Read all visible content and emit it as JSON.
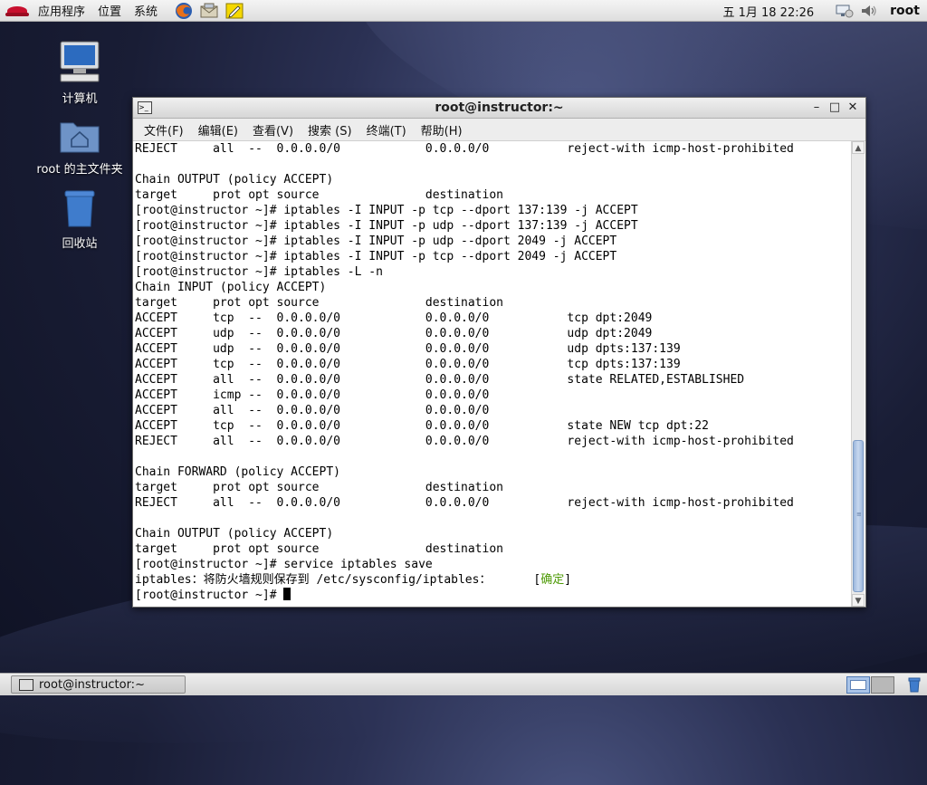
{
  "top_panel": {
    "menus": [
      "应用程序",
      "位置",
      "系统"
    ],
    "clock": "五 1月 18 22:26",
    "user": "root"
  },
  "desktop_icons": [
    {
      "label": "计算机"
    },
    {
      "label": "root 的主文件夹"
    },
    {
      "label": "回收站"
    }
  ],
  "window": {
    "title": "root@instructor:~",
    "menus": [
      "文件(F)",
      "编辑(E)",
      "查看(V)",
      "搜索 (S)",
      "终端(T)",
      "帮助(H)"
    ]
  },
  "terminal": {
    "lines": [
      "REJECT     all  --  0.0.0.0/0            0.0.0.0/0           reject-with icmp-host-prohibited",
      "",
      "Chain OUTPUT (policy ACCEPT)",
      "target     prot opt source               destination",
      "[root@instructor ~]# iptables -I INPUT -p tcp --dport 137:139 -j ACCEPT",
      "[root@instructor ~]# iptables -I INPUT -p udp --dport 137:139 -j ACCEPT",
      "[root@instructor ~]# iptables -I INPUT -p udp --dport 2049 -j ACCEPT",
      "[root@instructor ~]# iptables -I INPUT -p tcp --dport 2049 -j ACCEPT",
      "[root@instructor ~]# iptables -L -n",
      "Chain INPUT (policy ACCEPT)",
      "target     prot opt source               destination",
      "ACCEPT     tcp  --  0.0.0.0/0            0.0.0.0/0           tcp dpt:2049",
      "ACCEPT     udp  --  0.0.0.0/0            0.0.0.0/0           udp dpt:2049",
      "ACCEPT     udp  --  0.0.0.0/0            0.0.0.0/0           udp dpts:137:139",
      "ACCEPT     tcp  --  0.0.0.0/0            0.0.0.0/0           tcp dpts:137:139",
      "ACCEPT     all  --  0.0.0.0/0            0.0.0.0/0           state RELATED,ESTABLISHED",
      "ACCEPT     icmp --  0.0.0.0/0            0.0.0.0/0",
      "ACCEPT     all  --  0.0.0.0/0            0.0.0.0/0",
      "ACCEPT     tcp  --  0.0.0.0/0            0.0.0.0/0           state NEW tcp dpt:22",
      "REJECT     all  --  0.0.0.0/0            0.0.0.0/0           reject-with icmp-host-prohibited",
      "",
      "Chain FORWARD (policy ACCEPT)",
      "target     prot opt source               destination",
      "REJECT     all  --  0.0.0.0/0            0.0.0.0/0           reject-with icmp-host-prohibited",
      "",
      "Chain OUTPUT (policy ACCEPT)",
      "target     prot opt source               destination",
      "[root@instructor ~]# service iptables save"
    ],
    "save_line_prefix": "iptables：将防火墙规则保存到 /etc/sysconfig/iptables：      [",
    "save_line_status": "确定",
    "save_line_suffix": "]",
    "prompt": "[root@instructor ~]# "
  },
  "taskbar": {
    "task_label": "root@instructor:~"
  },
  "colors": {
    "ok_green": "#4e9a06",
    "scroll_thumb": "#9cb7dc"
  }
}
